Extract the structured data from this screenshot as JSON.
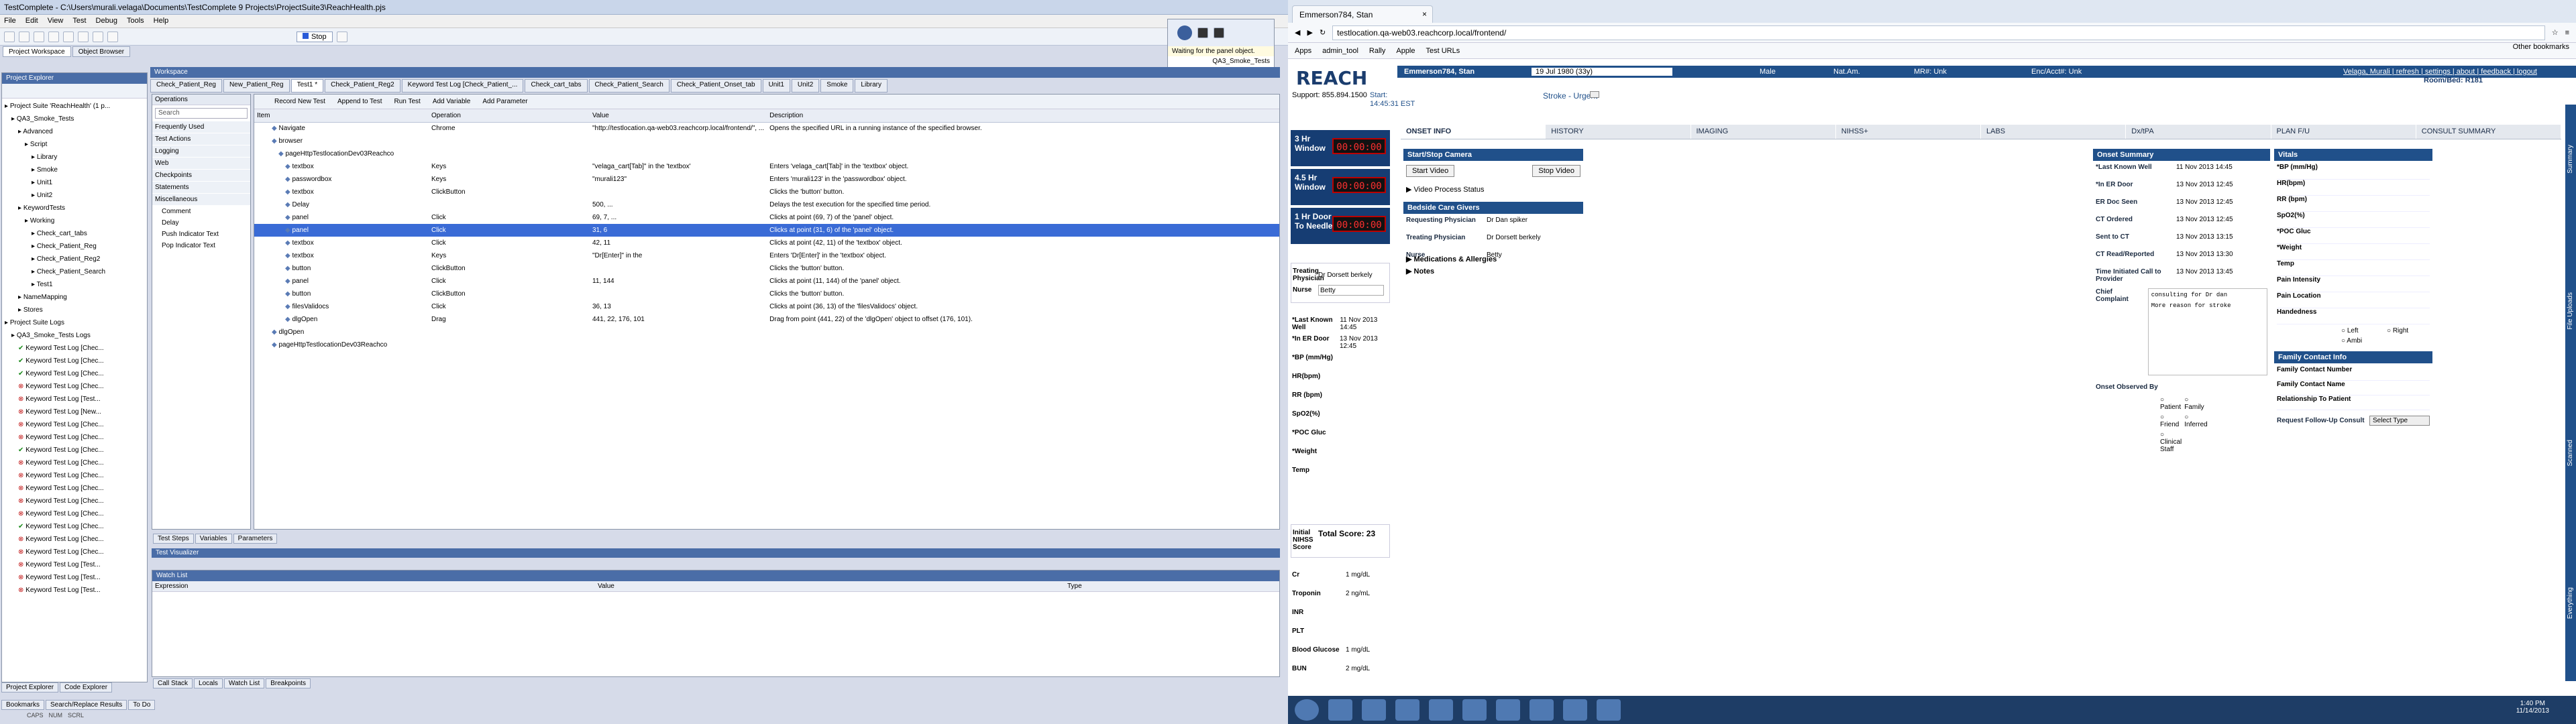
{
  "tc": {
    "title": "TestComplete - C:\\Users\\murali.velaga\\Documents\\TestComplete 9 Projects\\ProjectSuite3\\ReachHealth.pjs",
    "menu": [
      "File",
      "Edit",
      "View",
      "Test",
      "Debug",
      "Tools",
      "Help"
    ],
    "stop_label": "Stop",
    "tooltip_line1": "Waiting for the panel object.",
    "tooltip_line2": "QA3_Smoke_Tests",
    "tabs_left": [
      "Project Workspace",
      "Object Browser"
    ],
    "workspace_label": "Workspace",
    "doc_tabs": [
      "Check_Patient_Reg",
      "New_Patient_Reg",
      "Test1 *",
      "Check_Patient_Reg2",
      "Keyword Test Log [Check_Patient_...",
      "Check_cart_tabs",
      "Check_Patient_Search",
      "Check_Patient_Onset_tab",
      "Unit1",
      "Unit2",
      "Smoke",
      "Library"
    ],
    "explorer_title": "Project Explorer",
    "tree": [
      {
        "t": "Project Suite 'ReachHealth' (1 p...",
        "i": 0,
        "c": ""
      },
      {
        "t": "QA3_Smoke_Tests",
        "i": 1,
        "c": "b"
      },
      {
        "t": "Advanced",
        "i": 2,
        "c": ""
      },
      {
        "t": "Script",
        "i": 3,
        "c": ""
      },
      {
        "t": "Library",
        "i": 4,
        "c": ""
      },
      {
        "t": "Smoke",
        "i": 4,
        "c": ""
      },
      {
        "t": "Unit1",
        "i": 4,
        "c": ""
      },
      {
        "t": "Unit2",
        "i": 4,
        "c": ""
      },
      {
        "t": "KeywordTests",
        "i": 2,
        "c": ""
      },
      {
        "t": "Working",
        "i": 3,
        "c": ""
      },
      {
        "t": "Check_cart_tabs",
        "i": 4,
        "c": ""
      },
      {
        "t": "Check_Patient_Reg",
        "i": 4,
        "c": ""
      },
      {
        "t": "Check_Patient_Reg2",
        "i": 4,
        "c": ""
      },
      {
        "t": "Check_Patient_Search",
        "i": 4,
        "c": ""
      },
      {
        "t": "Test1",
        "i": 4,
        "c": ""
      },
      {
        "t": "NameMapping",
        "i": 2,
        "c": ""
      },
      {
        "t": "Stores",
        "i": 2,
        "c": ""
      },
      {
        "t": "Project Suite Logs",
        "i": 0,
        "c": ""
      },
      {
        "t": "QA3_Smoke_Tests Logs",
        "i": 1,
        "c": ""
      },
      {
        "t": "Keyword Test Log [Chec...",
        "i": 2,
        "c": "ok"
      },
      {
        "t": "Keyword Test Log [Chec...",
        "i": 2,
        "c": "ok"
      },
      {
        "t": "Keyword Test Log [Chec...",
        "i": 2,
        "c": "ok"
      },
      {
        "t": "Keyword Test Log [Chec...",
        "i": 2,
        "c": "err"
      },
      {
        "t": "Keyword Test Log [Test...",
        "i": 2,
        "c": "err"
      },
      {
        "t": "Keyword Test Log [New...",
        "i": 2,
        "c": "err"
      },
      {
        "t": "Keyword Test Log [Chec...",
        "i": 2,
        "c": "err"
      },
      {
        "t": "Keyword Test Log [Chec...",
        "i": 2,
        "c": "err"
      },
      {
        "t": "Keyword Test Log [Chec...",
        "i": 2,
        "c": "ok"
      },
      {
        "t": "Keyword Test Log [Chec...",
        "i": 2,
        "c": "err"
      },
      {
        "t": "Keyword Test Log [Chec...",
        "i": 2,
        "c": "err"
      },
      {
        "t": "Keyword Test Log [Chec...",
        "i": 2,
        "c": "err"
      },
      {
        "t": "Keyword Test Log [Chec...",
        "i": 2,
        "c": "err"
      },
      {
        "t": "Keyword Test Log [Chec...",
        "i": 2,
        "c": "err"
      },
      {
        "t": "Keyword Test Log [Chec...",
        "i": 2,
        "c": "ok"
      },
      {
        "t": "Keyword Test Log [Chec...",
        "i": 2,
        "c": "err"
      },
      {
        "t": "Keyword Test Log [Chec...",
        "i": 2,
        "c": "err"
      },
      {
        "t": "Keyword Test Log [Test...",
        "i": 2,
        "c": "err"
      },
      {
        "t": "Keyword Test Log [Test...",
        "i": 2,
        "c": "err"
      },
      {
        "t": "Keyword Test Log [Test...",
        "i": 2,
        "c": "err"
      }
    ],
    "explorer_bottom_tabs": [
      "Project Explorer",
      "Code Explorer"
    ],
    "left_status_tabs": [
      "Bookmarks",
      "Search/Replace Results",
      "To Do"
    ],
    "ops_title": "Operations",
    "ops_search": "Search",
    "ops": [
      "Frequently Used",
      "Test Actions",
      "Logging",
      "Web",
      "Checkpoints",
      "Statements",
      "Miscellaneous",
      "Comment",
      "Delay",
      "Push Indicator Text",
      "Pop Indicator Text"
    ],
    "kt_toolbar": [
      "Record New Test",
      "Append to Test",
      "Run Test",
      "Add Variable",
      "Add Parameter"
    ],
    "cols": [
      "Item",
      "Operation",
      "Value",
      "Description"
    ],
    "rows": [
      {
        "item": "Navigate",
        "op": "Chrome",
        "val": "\"http://testlocation.qa-web03.reachcorp.local/frontend/\", ...",
        "desc": "Opens the specified URL in a running instance of the specified browser.",
        "i": 1
      },
      {
        "item": "browser",
        "op": "",
        "val": "",
        "desc": "",
        "i": 1
      },
      {
        "item": "pageHttpTestlocationDev03Reachco",
        "op": "",
        "val": "",
        "desc": "",
        "i": 2
      },
      {
        "item": "textbox",
        "op": "Keys",
        "val": "\"velaga_cart[Tab]\" in the 'textbox'",
        "desc": "Enters 'velaga_cart[Tab]' in the 'textbox' object.",
        "i": 3
      },
      {
        "item": "passwordbox",
        "op": "Keys",
        "val": "\"murali123\"",
        "desc": "Enters 'murali123' in the 'passwordbox' object.",
        "i": 3
      },
      {
        "item": "textbox",
        "op": "ClickButton",
        "val": "",
        "desc": "Clicks the 'button' button.",
        "i": 3
      },
      {
        "item": "Delay",
        "op": "",
        "val": "500, ...",
        "desc": "Delays the test execution for the specified time period.",
        "i": 3
      },
      {
        "item": "panel",
        "op": "Click",
        "val": "69, 7, ...",
        "desc": "Clicks at point (69, 7) of the 'panel' object.",
        "i": 3
      },
      {
        "item": "panel",
        "op": "Click",
        "val": "31, 6",
        "desc": "Clicks at point (31, 6) of the 'panel' object.",
        "i": 3,
        "sel": true
      },
      {
        "item": "textbox",
        "op": "Click",
        "val": "42, 11",
        "desc": "Clicks at point (42, 11) of the 'textbox' object.",
        "i": 3
      },
      {
        "item": "textbox",
        "op": "Keys",
        "val": "\"Dr[Enter]\" in the",
        "desc": "Enters 'Dr[Enter]' in the 'textbox' object.",
        "i": 3
      },
      {
        "item": "button",
        "op": "ClickButton",
        "val": "",
        "desc": "Clicks the 'button' button.",
        "i": 3
      },
      {
        "item": "panel",
        "op": "Click",
        "val": "11, 144",
        "desc": "Clicks at point (11, 144) of the 'panel' object.",
        "i": 3
      },
      {
        "item": "button",
        "op": "ClickButton",
        "val": "",
        "desc": "Clicks the 'button' button.",
        "i": 3
      },
      {
        "item": "filesValidocs",
        "op": "Click",
        "val": "36, 13",
        "desc": "Clicks at point (36, 13) of the 'filesValidocs' object.",
        "i": 3
      },
      {
        "item": "dlgOpen",
        "op": "Drag",
        "val": "441, 22, 176, 101",
        "desc": "Drag from point (441, 22) of the 'dlgOpen' object to offset (176, 101).",
        "i": 3
      },
      {
        "item": "dlgOpen",
        "op": "",
        "val": "",
        "desc": "",
        "i": 1
      },
      {
        "item": "pageHttpTestlocationDev03Reachco",
        "op": "",
        "val": "",
        "desc": "",
        "i": 1
      }
    ],
    "kt_bottom_tabs": [
      "Test Steps",
      "Variables",
      "Parameters"
    ],
    "visualizer": "Test Visualizer",
    "watch_title": "Watch List",
    "watch_cols": [
      "Expression",
      "Value",
      "Type"
    ],
    "bottom_tabs": [
      "Call Stack",
      "Locals",
      "Watch List",
      "Breakpoints"
    ],
    "status": [
      "CAPS",
      "NUM",
      "SCRL"
    ]
  },
  "browser": {
    "tab_title": "Emmerson784, Stan",
    "url": "testlocation.qa-web03.reachcorp.local/frontend/",
    "bookmarks": [
      "Apps",
      "admin_tool",
      "Rally",
      "Apple",
      "Test URLs"
    ],
    "other_bookmarks": "Other bookmarks"
  },
  "reach": {
    "logo": "REACH",
    "patient_name": "Emmerson784, Stan",
    "dob": "19 Jul 1980 (33y)",
    "sex": "Male",
    "nat": "Nat.Am.",
    "mr": "MR#: Unk",
    "enc": "Enc/Acct#: Unk",
    "user_links": [
      "Velaga, Murali",
      "refresh",
      "settings",
      "about",
      "feedback",
      "logout"
    ],
    "room": "Room/Bed: R181",
    "support": "Support: 855.894.1500",
    "start_label": "Start:",
    "start_time": "14:45:31 EST",
    "stroke": "Stroke - Urgent",
    "timers": [
      {
        "label": "3 Hr Window",
        "value": "00:00:00"
      },
      {
        "label": "4.5 Hr Window",
        "value": "00:00:00"
      },
      {
        "label": "1 Hr Door To Needle",
        "value": "00:00:00"
      }
    ],
    "treating_label": "Treating Physician",
    "treating_value": "Dr Dorsett berkely",
    "nurse_label": "Nurse",
    "nurse_value": "Betty",
    "left_vitals": [
      {
        "k": "*Last Known Well",
        "v": "11 Nov 2013 14:45"
      },
      {
        "k": "*In ER Door",
        "v": "13 Nov 2013 12:45"
      },
      {
        "k": "*BP (mm/Hg)",
        "v": ""
      },
      {
        "k": "HR(bpm)",
        "v": ""
      },
      {
        "k": "RR (bpm)",
        "v": ""
      },
      {
        "k": "SpO2(%)",
        "v": ""
      },
      {
        "k": "*POC Gluc",
        "v": ""
      },
      {
        "k": "*Weight",
        "v": ""
      },
      {
        "k": "Temp",
        "v": ""
      }
    ],
    "nihss_label": "Initial NIHSS Score",
    "nihss_total": "Total Score: 23",
    "labs": [
      {
        "k": "Cr",
        "v": "1 mg/dL"
      },
      {
        "k": "Troponin",
        "v": "2 ng/mL"
      },
      {
        "k": "INR",
        "v": ""
      },
      {
        "k": "PLT",
        "v": ""
      },
      {
        "k": "Blood Glucose",
        "v": "1 mg/dL"
      },
      {
        "k": "BUN",
        "v": "2 mg/dL"
      }
    ],
    "tabs": [
      "ONSET INFO",
      "HISTORY",
      "IMAGING",
      "NIHSS+",
      "LABS",
      "Dx/tPA",
      "PLAN F/U",
      "CONSULT SUMMARY"
    ],
    "camera_title": "Start/Stop Camera",
    "start_video": "Start Video",
    "stop_video": "Stop Video",
    "video_status": "Video Process Status",
    "bedside_title": "Bedside Care Givers",
    "bedside": [
      {
        "k": "Requesting Physician",
        "v": "Dr Dan spiker"
      },
      {
        "k": "Treating Physician",
        "v": "Dr Dorsett berkely"
      },
      {
        "k": "Nurse",
        "v": "Betty"
      }
    ],
    "onset_title": "Onset Summary",
    "onset": [
      {
        "k": "*Last Known Well",
        "v": "11 Nov 2013 14:45"
      },
      {
        "k": "*In ER Door",
        "v": "13 Nov 2013 12:45"
      },
      {
        "k": "ER Doc Seen",
        "v": "13 Nov 2013 12:45"
      },
      {
        "k": "CT Ordered",
        "v": "13 Nov 2013 12:45"
      },
      {
        "k": "Sent to CT",
        "v": "13 Nov 2013 13:15"
      },
      {
        "k": "CT Read/Reported",
        "v": "13 Nov 2013 13:30"
      },
      {
        "k": "Time Initiated Call to Provider",
        "v": "13 Nov 2013 13:45"
      }
    ],
    "chief_label": "Chief Complaint",
    "chief_line1": "consulting for Dr dan",
    "chief_line2": "More reason for stroke",
    "observed_label": "Onset Observed By",
    "observed": [
      "Patient",
      "Family",
      "Friend",
      "Inferred",
      "Clinical Staff"
    ],
    "vitals_title": "Vitals",
    "vitals": [
      "*BP (mm/Hg)",
      "HR(bpm)",
      "RR (bpm)",
      "SpO2(%)",
      "*POC Gluc",
      "*Weight",
      "Temp",
      "Pain Intensity",
      "Pain Location",
      "Handedness"
    ],
    "hand": [
      "Left",
      "Right",
      "Ambi"
    ],
    "family_title": "Family Contact Info",
    "family": [
      "Family Contact Number",
      "Family Contact Name",
      "Relationship To Patient"
    ],
    "followup_label": "Request Follow-Up Consult",
    "followup_value": "Select Type",
    "meds": "Medications & Allergies",
    "notes": "Notes",
    "side_tabs": [
      "Summary",
      "File Uploads",
      "Scanned",
      "Everything"
    ]
  },
  "taskbar": {
    "time": "1:40 PM",
    "date": "11/14/2013"
  }
}
